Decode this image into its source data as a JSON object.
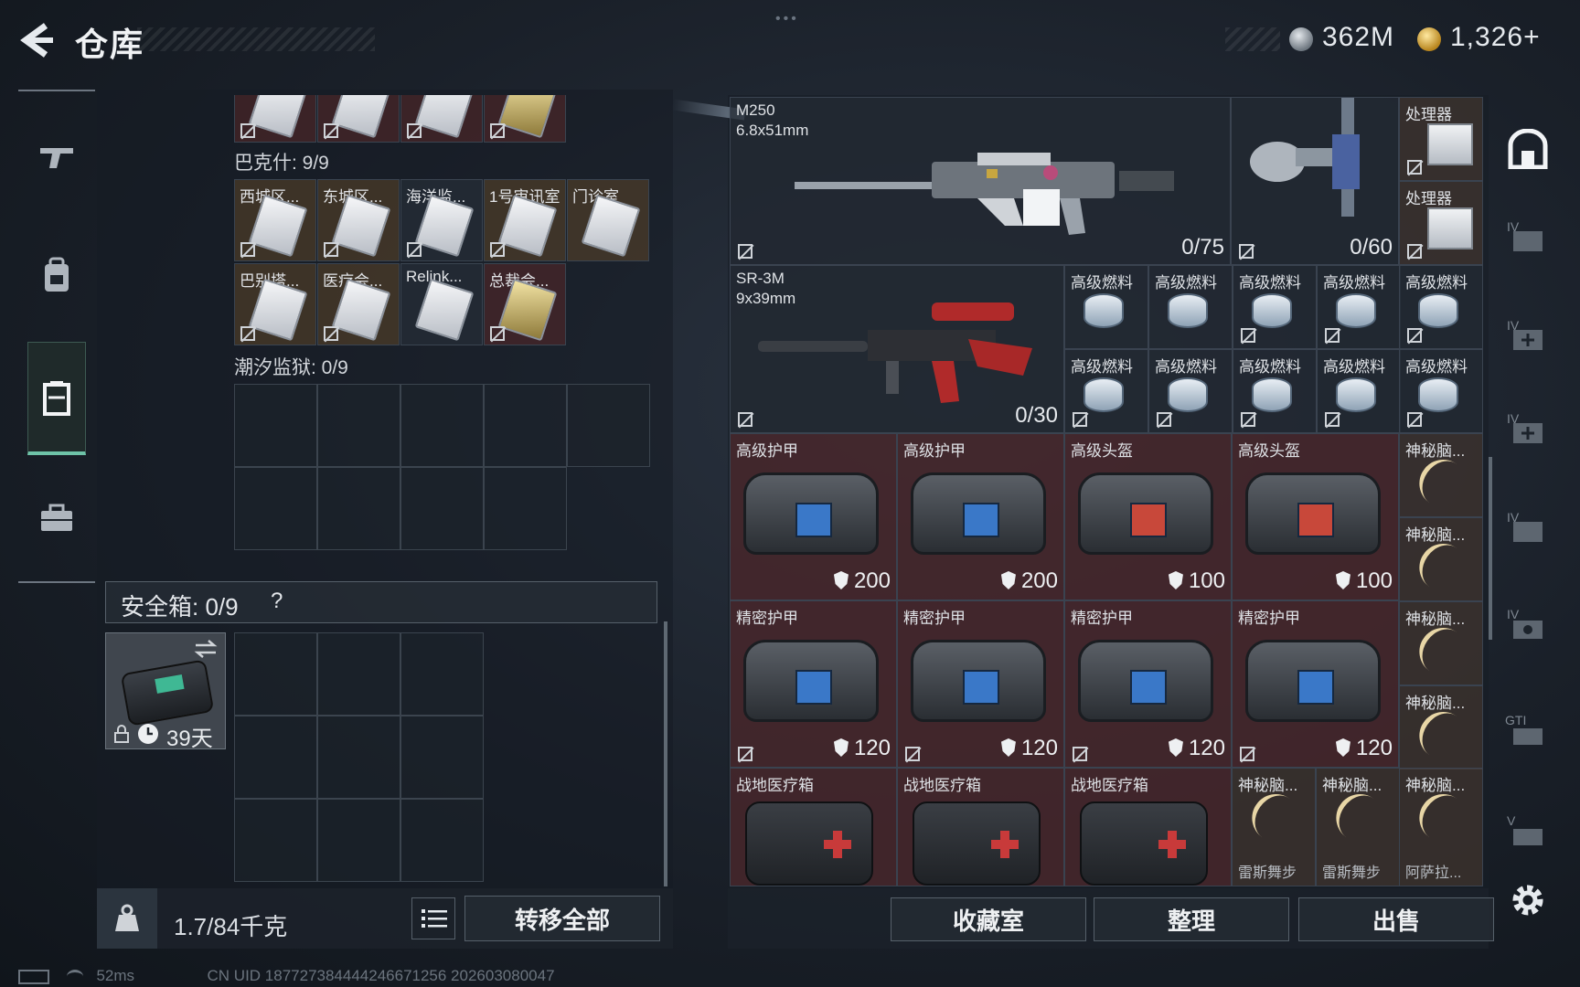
{
  "header": {
    "title": "仓库",
    "currency_1": "362M",
    "currency_2": "1,326+"
  },
  "left_panel": {
    "top_row": [
      {
        "label": "",
        "tone": "red",
        "gold": false
      },
      {
        "label": "",
        "tone": "red",
        "gold": false
      },
      {
        "label": "",
        "tone": "red",
        "gold": false
      },
      {
        "label": "",
        "tone": "red",
        "gold": true
      }
    ],
    "section_bakshi": "巴克什: 9/9",
    "bakshi_items": [
      {
        "label": "西城区...",
        "tone": "gold",
        "gold": false
      },
      {
        "label": "东城区...",
        "tone": "gold",
        "gold": false
      },
      {
        "label": "海洋监...",
        "tone": "dark",
        "gold": false
      },
      {
        "label": "1号审讯室",
        "tone": "gold",
        "gold": false
      },
      {
        "label": "门诊室",
        "tone": "gold",
        "gold": false
      },
      {
        "label": "巴别塔...",
        "tone": "gold",
        "gold": false
      },
      {
        "label": "医疗会...",
        "tone": "gold",
        "gold": false
      },
      {
        "label": "Relink...",
        "tone": "dark",
        "gold": false
      },
      {
        "label": "总裁会...",
        "tone": "red",
        "gold": true
      }
    ],
    "section_tide": "潮汐监狱: 0/9",
    "safe_label": "安全箱: 0/9",
    "safe_help": "?",
    "safe_days": "39天",
    "weight": "1.7/84千克",
    "transfer_all": "转移全部"
  },
  "right_panel": {
    "m250": {
      "name": "M250",
      "ammo": "6.8x51mm",
      "count": "0/75"
    },
    "mag": {
      "count": "0/60"
    },
    "processors": [
      "处理器",
      "处理器"
    ],
    "sr3m": {
      "name": "SR-3M",
      "ammo": "9x39mm",
      "count": "0/30"
    },
    "fuel": [
      "高级燃料",
      "高级燃料",
      "高级燃料",
      "高级燃料",
      "高级燃料",
      "高级燃料",
      "高级燃料",
      "高级燃料",
      "高级燃料",
      "高级燃料"
    ],
    "armor_row": [
      {
        "name": "高级护甲",
        "dur": "200",
        "red": false
      },
      {
        "name": "高级护甲",
        "dur": "200",
        "red": false
      },
      {
        "name": "高级头盔",
        "dur": "100",
        "red": true
      },
      {
        "name": "高级头盔",
        "dur": "100",
        "red": true
      }
    ],
    "precise_row": [
      {
        "name": "精密护甲",
        "dur": "120"
      },
      {
        "name": "精密护甲",
        "dur": "120"
      },
      {
        "name": "精密护甲",
        "dur": "120"
      },
      {
        "name": "精密护甲",
        "dur": "120"
      }
    ],
    "brains_col": [
      "神秘脑...",
      "神秘脑...",
      "神秘脑...",
      "神秘脑..."
    ],
    "medkits": [
      "战地医疗箱",
      "战地医疗箱",
      "战地医疗箱"
    ],
    "bottom_brains": [
      {
        "name": "神秘脑...",
        "sub": "雷斯舞步"
      },
      {
        "name": "神秘脑...",
        "sub": "雷斯舞步"
      },
      {
        "name": "神秘脑...",
        "sub": "阿萨拉..."
      }
    ],
    "actions": {
      "collection": "收藏室",
      "organize": "整理",
      "sell": "出售"
    }
  },
  "right_rail": {
    "labels": [
      "IV",
      "IV",
      "IV",
      "IV",
      "IV",
      "GTI",
      "V"
    ]
  },
  "status": {
    "ping": "52ms",
    "uid": "CN UID 187727384444246671256 202603080047"
  },
  "colors": {
    "accent": "#6ec3a8",
    "red_cell": "#562a2c",
    "gold_coin": "#b8851d"
  }
}
